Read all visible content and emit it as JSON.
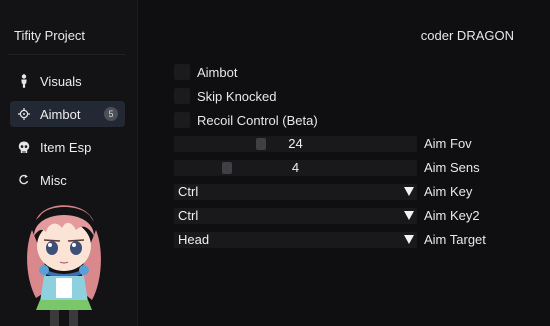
{
  "sidebar": {
    "brand": "Tifity Project",
    "items": [
      {
        "label": "Visuals",
        "icon": "person-icon",
        "active": false
      },
      {
        "label": "Aimbot",
        "icon": "crosshair-icon",
        "active": true,
        "badge": "5"
      },
      {
        "label": "Item Esp",
        "icon": "skull-icon",
        "active": false
      },
      {
        "label": "Misc",
        "icon": "refresh-icon",
        "active": false
      }
    ]
  },
  "header": {
    "coder": "coder DRAGON"
  },
  "checkboxes": [
    {
      "label": "Aimbot",
      "checked": false
    },
    {
      "label": "Skip Knocked",
      "checked": false
    },
    {
      "label": "Recoil Control (Beta)",
      "checked": false
    }
  ],
  "sliders": [
    {
      "label": "Aim Fov",
      "value": "24"
    },
    {
      "label": "Aim Sens",
      "value": "4"
    }
  ],
  "combos": [
    {
      "label": "Aim Key",
      "value": "Ctrl"
    },
    {
      "label": "Aim Key2",
      "value": "Ctrl"
    },
    {
      "label": "Aim Target",
      "value": "Head"
    }
  ],
  "colors": {
    "accent": "#232934",
    "panel": "#19191c",
    "text": "#e8e8e8"
  }
}
